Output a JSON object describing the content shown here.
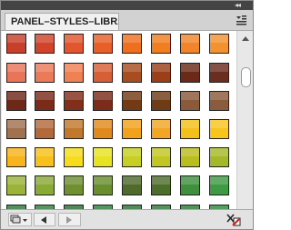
{
  "panel": {
    "tab_title": "PANEL–STYLES–LIBRARY",
    "collapse_glyph": "◂◂",
    "close_glyph": "×"
  },
  "swatches": {
    "rows": [
      [
        "#c9402a",
        "#d1432a",
        "#e2552e",
        "#e85f28",
        "#f06f1f",
        "#f17e1f",
        "#f2842b",
        "#f39330"
      ],
      [
        "#e8745a",
        "#ea7a58",
        "#ef8153",
        "#d75f35",
        "#a84d1f",
        "#9a3f17",
        "#6a2a17",
        "#6b2d1f"
      ],
      [
        "#6e2818",
        "#7a2b19",
        "#812f1b",
        "#7b2c1a",
        "#743a16",
        "#6e3d18",
        "#8a5a3b",
        "#8b5b3d"
      ],
      [
        "#a27150",
        "#b36a3b",
        "#c0782c",
        "#e08a1d",
        "#f2a11c",
        "#f1a626",
        "#f4c01b",
        "#f7c51e"
      ],
      [
        "#f7b41d",
        "#f8c01a",
        "#f6dc1c",
        "#e8e322",
        "#c6cf22",
        "#c2c622",
        "#b9be1f",
        "#a5b928"
      ],
      [
        "#9ab338",
        "#8aaa36",
        "#6f8f31",
        "#6a8e2e",
        "#4f6a2b",
        "#4d6e2a",
        "#3f8f3d",
        "#3f9a44"
      ],
      [
        "#2f7a3a",
        "#31803e",
        "#2a6e34",
        "#2f7f3b",
        "#2b7434",
        "#2e7a36",
        "#2c7a38",
        "#2e8a3e"
      ]
    ]
  },
  "bottom_bar": {
    "library_menu_icon": "library-menu-icon",
    "prev_icon": "chevron-left-icon",
    "next_icon": "chevron-right-icon",
    "delete_icon": "delete-style-icon"
  },
  "colors": {
    "titlebar": "#444444",
    "panel_bg": "#ebebeb",
    "swatch_border": "#222222"
  }
}
